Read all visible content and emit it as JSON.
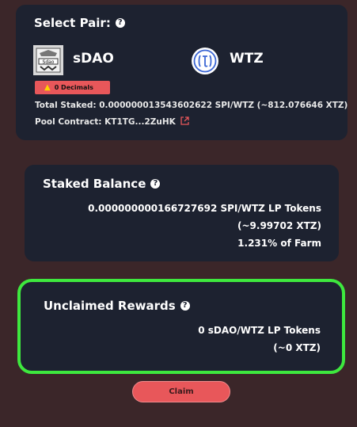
{
  "pair": {
    "title": "Select Pair:",
    "help": "?",
    "token_a": {
      "name": "sDAO",
      "logo_text": "Sdao",
      "icon": "sdao-logo"
    },
    "token_b": {
      "name": "WTZ",
      "icon": "wtz-logo"
    },
    "decimals_badge": "0 Decimals",
    "total_staked": "Total Staked: 0.000000013543602622 SPI/WTZ (~812.076646 XTZ)",
    "pool_contract": "Pool Contract: KT1TG...2ZuHK"
  },
  "staked": {
    "title": "Staked Balance",
    "help": "?",
    "amount": "0.000000000166727692 SPI/WTZ LP Tokens",
    "xtz": "(~9.99702 XTZ)",
    "percent": "1.231% of Farm"
  },
  "rewards": {
    "title": "Unclaimed Rewards",
    "help": "?",
    "amount": "0 sDAO/WTZ LP Tokens",
    "xtz": "(~0 XTZ)"
  },
  "claim_label": "Claim",
  "colors": {
    "background": "#3b2629",
    "card": "#1d2230",
    "accent": "#e8575a",
    "highlight": "#3ee83e"
  }
}
